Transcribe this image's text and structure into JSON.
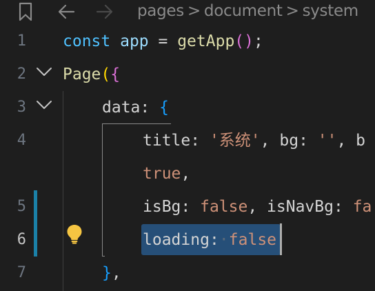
{
  "toolbar": {
    "bookmark_icon": "bookmark-icon",
    "back_icon": "arrow-left-icon",
    "forward_icon": "arrow-right-icon"
  },
  "breadcrumb": {
    "items": [
      "pages",
      "document",
      "system"
    ],
    "separator": ">"
  },
  "editor": {
    "line_numbers": [
      "1",
      "2",
      "3",
      "4",
      "5",
      "6",
      "7"
    ],
    "current_line": "6",
    "lines": {
      "l1": {
        "const": "const",
        "app": " app ",
        "eq": "= ",
        "fn": "getApp",
        "parens": "()",
        "semi": ";"
      },
      "l2": {
        "page": "Page",
        "paren": "(",
        "brace": "{"
      },
      "l3": {
        "data": "data",
        "colon": ": ",
        "brace": "{"
      },
      "l4": {
        "title": "title",
        "colon": ": ",
        "str": "'系统'",
        "comma": ", ",
        "bg": "bg",
        "colon2": ": ",
        "str2": "''",
        "comma2": ", ",
        "tail": "b"
      },
      "l4b": {
        "val": "true",
        "comma": ","
      },
      "l5": {
        "isBg": "isBg",
        "colon": ": ",
        "val": "false",
        "comma": ", ",
        "isNavBg": "isNavBg",
        "colon2": ": ",
        "tail": "fa"
      },
      "l6": {
        "loading": "loading",
        "colon": ":",
        "val": "false"
      },
      "l7": {
        "brace": "}",
        "comma": ","
      }
    },
    "lightbulb_icon": "lightbulb-icon",
    "fold_icon": "chevron-down-icon",
    "colors": {
      "background": "#1e1e1e",
      "selection": "#264f78",
      "modified": "#1b81a8",
      "lightbulb": "#f5c542"
    }
  }
}
